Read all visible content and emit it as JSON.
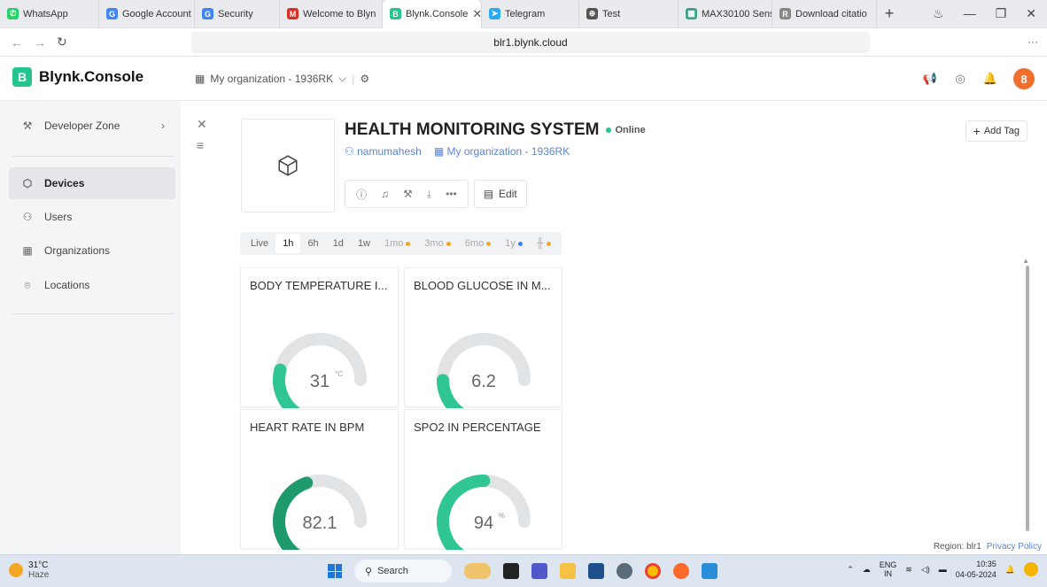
{
  "browser": {
    "tabs": [
      {
        "title": "WhatsApp",
        "color": "#25d366",
        "glyph": "✆",
        "active": false
      },
      {
        "title": "Google Account",
        "color": "#4285f4",
        "glyph": "G",
        "active": false
      },
      {
        "title": "Security",
        "color": "#4285f4",
        "glyph": "G",
        "active": false
      },
      {
        "title": "Welcome to Blyn",
        "color": "#d93025",
        "glyph": "M",
        "active": false
      },
      {
        "title": "Blynk.Console",
        "color": "#23c48e",
        "glyph": "B",
        "active": true
      },
      {
        "title": "Telegram",
        "color": "#2aabee",
        "glyph": "➤",
        "active": false
      },
      {
        "title": "Test",
        "color": "#555555",
        "glyph": "⊕",
        "active": false
      },
      {
        "title": "MAX30100 Senso",
        "color": "#3aa58a",
        "glyph": "▦",
        "active": false
      },
      {
        "title": "Download citatio",
        "color": "#888888",
        "glyph": "R",
        "active": false
      }
    ],
    "url": "blr1.blynk.cloud"
  },
  "header": {
    "brand_letter": "B",
    "brand_name": "Blynk.Console",
    "org_selector": "My organization - 1936RK",
    "avatar_letter": "8"
  },
  "sidebar": {
    "developer_zone": "Developer Zone",
    "items": [
      {
        "label": "Devices",
        "icon": "cube-icon",
        "active": true
      },
      {
        "label": "Users",
        "icon": "users-icon",
        "active": false
      },
      {
        "label": "Organizations",
        "icon": "building-icon",
        "active": false
      },
      {
        "label": "Locations",
        "icon": "location-pin-icon",
        "active": false
      }
    ]
  },
  "device": {
    "name": "HEALTH MONITORING SYSTEM",
    "status": "Online",
    "owner": "namumahesh",
    "organization": "My organization - 1936RK",
    "edit_label": "Edit",
    "add_tag_label": "Add Tag"
  },
  "time_ranges": [
    {
      "label": "Live",
      "selected": false,
      "dim": false,
      "dot": null
    },
    {
      "label": "1h",
      "selected": true,
      "dim": false,
      "dot": null
    },
    {
      "label": "6h",
      "selected": false,
      "dim": false,
      "dot": null
    },
    {
      "label": "1d",
      "selected": false,
      "dim": false,
      "dot": null
    },
    {
      "label": "1w",
      "selected": false,
      "dim": false,
      "dot": null
    },
    {
      "label": "1mo",
      "selected": false,
      "dim": true,
      "dot": "#f5a623"
    },
    {
      "label": "3mo",
      "selected": false,
      "dim": true,
      "dot": "#f5a623"
    },
    {
      "label": "6mo",
      "selected": false,
      "dim": true,
      "dot": "#f5a623"
    },
    {
      "label": "1y",
      "selected": false,
      "dim": true,
      "dot": "#3b82f6"
    },
    {
      "label": "╫",
      "selected": false,
      "dim": true,
      "dot": "#f5a623"
    }
  ],
  "widgets": [
    {
      "title": "BODY TEMPERATURE I...",
      "value": "31",
      "unit": "°C",
      "min": "0",
      "max": "100",
      "fraction": 0.31,
      "color": "#2fc694"
    },
    {
      "title": "BLOOD GLUCOSE IN M...",
      "value": "6.2",
      "unit": "",
      "min": "0",
      "max": "25",
      "fraction": 0.248,
      "color": "#2fc694"
    },
    {
      "title": "HEART RATE IN BPM",
      "value": "82.1",
      "unit": "",
      "min": "0",
      "max": "150",
      "fraction": 0.547,
      "color": "#1e9a6c"
    },
    {
      "title": "SPO2 IN PERCENTAGE",
      "value": "94",
      "unit": "%",
      "min": "0",
      "max": "150",
      "fraction": 0.627,
      "color": "#2fc694"
    }
  ],
  "footer": {
    "region": "Region: blr1",
    "privacy": "Privacy Policy"
  },
  "taskbar": {
    "temp": "31°C",
    "weather": "Haze",
    "search": "Search",
    "lang": "ENG",
    "lang2": "IN",
    "time": "10:35",
    "date": "04-05-2024"
  }
}
